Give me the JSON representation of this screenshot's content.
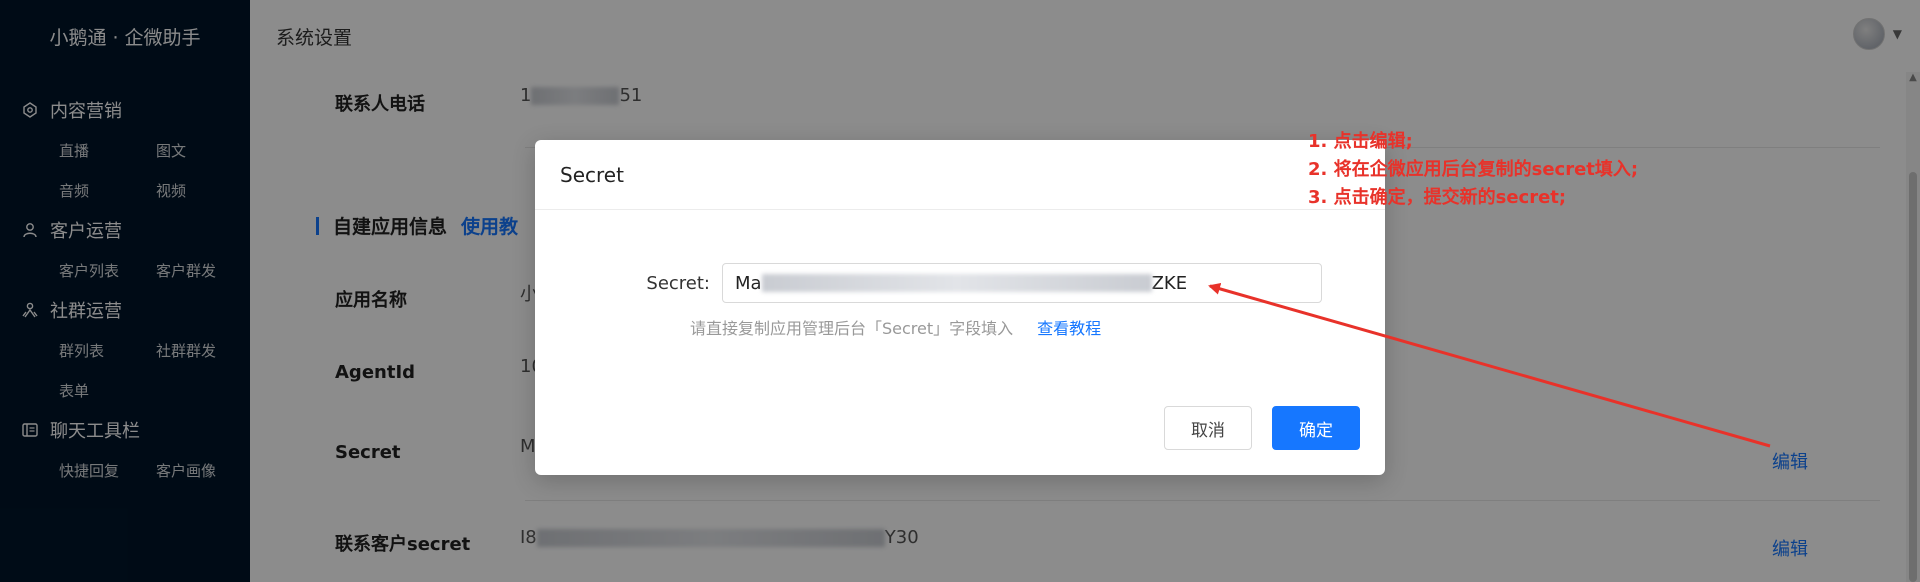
{
  "app": {
    "brand": "小鹅通 · 企微助手"
  },
  "sidebar": {
    "groups": [
      {
        "title": "内容营销",
        "icon": "content-icon",
        "items": [
          "直播",
          "图文",
          "音频",
          "视频"
        ]
      },
      {
        "title": "客户运营",
        "icon": "user-icon",
        "items": [
          "客户列表",
          "客户群发"
        ]
      },
      {
        "title": "社群运营",
        "icon": "group-icon",
        "items": [
          "群列表",
          "社群群发",
          "表单"
        ]
      },
      {
        "title": "聊天工具栏",
        "icon": "toolbar-icon",
        "items": [
          "快捷回复",
          "客户画像"
        ]
      }
    ]
  },
  "header": {
    "title": "系统设置"
  },
  "page": {
    "contact_phone": {
      "label": "联系人电话",
      "prefix": "1",
      "suffix": "51"
    },
    "section": {
      "title": "自建应用信息",
      "link": "使用教"
    },
    "app_name": {
      "label": "应用名称",
      "value_prefix": "小"
    },
    "agent_id": {
      "label": "AgentId",
      "value_prefix": "10"
    },
    "secret": {
      "label": "Secret",
      "value_prefix": "M",
      "edit": "编辑"
    },
    "customer_secret": {
      "label": "联系客户secret",
      "prefix": "I8",
      "suffix": "Y30",
      "edit": "编辑"
    }
  },
  "modal": {
    "title": "Secret",
    "field_label": "Secret:",
    "input_prefix": "Ma",
    "input_suffix": "ZKE",
    "hint": "请直接复制应用管理后台「Secret」字段填入",
    "hint_link": "查看教程",
    "cancel": "取消",
    "ok": "确定"
  },
  "annotation": {
    "lines": [
      "1. 点击编辑;",
      "2. 将在企微应用后台复制的secret填入;",
      "3. 点击确定，提交新的secret;"
    ],
    "color": "#e8322a"
  }
}
